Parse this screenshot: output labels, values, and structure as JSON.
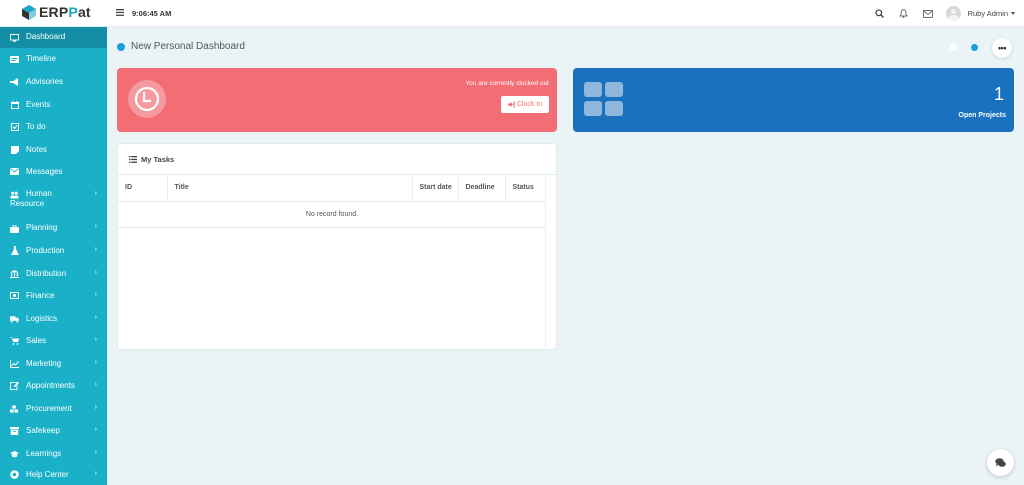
{
  "brand": {
    "logo_text_a": "ERP",
    "logo_text_b": "at",
    "logo_text_p": "P"
  },
  "topbar": {
    "time": "9:06:45 AM",
    "user_name": "Ruby Admin"
  },
  "sidebar": {
    "items": [
      {
        "label": "Dashboard",
        "icon": "monitor-icon",
        "has_submenu": false,
        "active": true
      },
      {
        "label": "Timeline",
        "icon": "timeline-icon",
        "has_submenu": false
      },
      {
        "label": "Advisories",
        "icon": "bullhorn-icon",
        "has_submenu": false
      },
      {
        "label": "Events",
        "icon": "calendar-icon",
        "has_submenu": false
      },
      {
        "label": "To do",
        "icon": "checkbox-icon",
        "has_submenu": false
      },
      {
        "label": "Notes",
        "icon": "note-icon",
        "has_submenu": false
      },
      {
        "label": "Messages",
        "icon": "envelope-icon",
        "has_submenu": false
      },
      {
        "label": "Human",
        "label2": "Resource",
        "icon": "users-icon",
        "has_submenu": true
      },
      {
        "label": "Planning",
        "icon": "briefcase-icon",
        "has_submenu": true
      },
      {
        "label": "Production",
        "icon": "flask-icon",
        "has_submenu": true
      },
      {
        "label": "Distribution",
        "icon": "bank-icon",
        "has_submenu": true
      },
      {
        "label": "Finance",
        "icon": "money-icon",
        "has_submenu": true
      },
      {
        "label": "Logistics",
        "icon": "truck-icon",
        "has_submenu": true
      },
      {
        "label": "Sales",
        "icon": "cart-icon",
        "has_submenu": true
      },
      {
        "label": "Marketing",
        "icon": "chart-line-icon",
        "has_submenu": true
      },
      {
        "label": "Appointments",
        "icon": "edit-icon",
        "has_submenu": true
      },
      {
        "label": "Procurement",
        "icon": "cubes-icon",
        "has_submenu": true
      },
      {
        "label": "Safekeep",
        "icon": "archive-icon",
        "has_submenu": true
      },
      {
        "label": "Learnings",
        "icon": "graduation-cap-icon",
        "has_submenu": true
      },
      {
        "label": "Help Center",
        "icon": "help-circle-icon",
        "has_submenu": true
      }
    ],
    "chevron": "›"
  },
  "main": {
    "page_title": "New Personal Dashboard",
    "more_label": "•••",
    "clock_card": {
      "status_text": "You are currently clocked out",
      "button_label": "Clock In"
    },
    "projects_card": {
      "count": "1",
      "label": "Open Projects"
    },
    "tasks": {
      "title": "My Tasks",
      "columns": [
        "ID",
        "Title",
        "Start date",
        "Deadline",
        "Status"
      ],
      "empty_text": "No record found."
    }
  },
  "colors": {
    "sidebar": "#1ab1c8",
    "sidebar_active": "#148ea5",
    "clock_card": "#f26d74",
    "projects_card": "#1a72be",
    "accent": "#1aa0d8"
  }
}
